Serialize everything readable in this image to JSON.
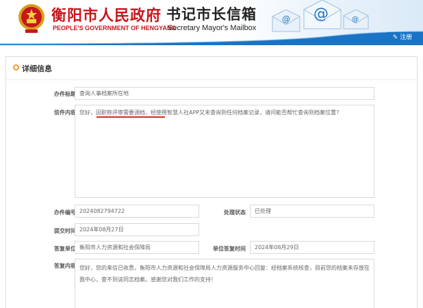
{
  "header": {
    "gov_title": "衡阳市人民政府",
    "gov_subtitle": "PEOPLE'S GOVERNMENT OF HENGYANG",
    "mailbox_title": "书记市长信箱",
    "mailbox_subtitle": "Secretary Mayor's Mailbox",
    "register_label": "注册"
  },
  "panel": {
    "title": "详细信息"
  },
  "fields": {
    "subject_label": "办件标题",
    "subject_value": "查询人事档案所在地",
    "content_label": "信件内容",
    "content_value": "您好，因职称评审需要调档，经使用智慧人社APP又未查询到任何档案记录，请问能否帮忙查询到档案位置?",
    "case_no_label": "办件编号",
    "case_no_value": "2024082794722",
    "status_label": "处理状态",
    "status_value": "已处理",
    "submit_time_label": "提交时间",
    "submit_time_value": "2024年08月27日",
    "reply_unit_label": "答复单位",
    "reply_unit_value": "衡阳市人力资源和社会保障局",
    "reply_time_label": "单位答复时间",
    "reply_time_value": "2024年08月29日",
    "reply_content_label": "答复内容",
    "reply_content_value": "您好，您的来信已收悉，衡阳市人力资源和社会保障局人力资源服务中心回复：经档案系统核查，目前您的档案未存放在我中心，查不到该同志档案。感谢您对我们工作的支持！"
  },
  "colors": {
    "brand_red": "#c8161d",
    "accent_blue": "#1a73c5",
    "accent_orange": "#f29a2e"
  }
}
